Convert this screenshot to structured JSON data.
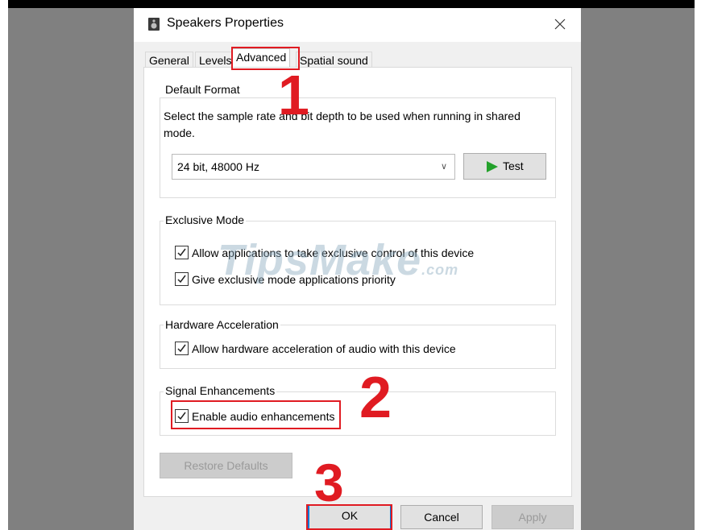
{
  "window": {
    "title": "Speakers Properties",
    "close_icon": "close-icon"
  },
  "tabs": [
    {
      "label": "General",
      "active": false
    },
    {
      "label": "Levels",
      "active": false
    },
    {
      "label": "Advanced",
      "active": true
    },
    {
      "label": "Spatial sound",
      "active": false
    }
  ],
  "default_format": {
    "label": "Default Format",
    "description": "Select the sample rate and bit depth to be used when running in shared mode.",
    "selected_format": "24 bit, 48000 Hz",
    "test_label": "Test"
  },
  "exclusive_mode": {
    "label": "Exclusive Mode",
    "options": [
      {
        "label": "Allow applications to take exclusive control of this device",
        "checked": true
      },
      {
        "label": "Give exclusive mode applications priority",
        "checked": true
      }
    ]
  },
  "hardware_acceleration": {
    "label": "Hardware Acceleration",
    "option": {
      "label": "Allow hardware acceleration of audio with this device",
      "checked": true
    }
  },
  "signal_enhancements": {
    "label": "Signal Enhancements",
    "option": {
      "label": "Enable audio enhancements",
      "checked": true
    }
  },
  "restore_defaults_label": "Restore Defaults",
  "footer": {
    "ok_label": "OK",
    "cancel_label": "Cancel",
    "apply_label": "Apply"
  },
  "annotations": {
    "step1": "1",
    "step2": "2",
    "step3": "3",
    "highlight_color": "#e01b22"
  },
  "watermark": {
    "text": "TipsMake",
    "suffix": ".com"
  }
}
